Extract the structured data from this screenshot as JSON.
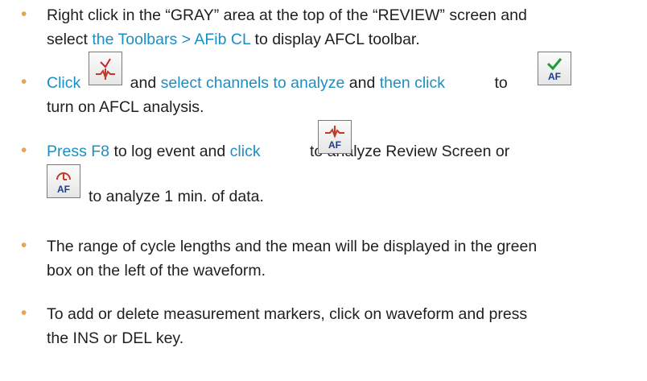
{
  "bullets": [
    {
      "line1": {
        "t1": "Right click in the “GRAY” area at the top of the “REVIEW” screen and"
      },
      "line2": {
        "t1": "select ",
        "link": "the Toolbars > AFib CL",
        "t2": " to display AFCL toolbar."
      }
    },
    {
      "line1": {
        "link1": "Click",
        "t1": " and ",
        "link2": "select channels to analyze",
        "t2": " and ",
        "link3": "then click",
        "t3": " to"
      },
      "line2": {
        "t1": "turn on AFCL analysis."
      }
    },
    {
      "line1": {
        "link1": "Press F8",
        "t1": " to log event and ",
        "link2": "click",
        "t2": " to analyze Review Screen or"
      },
      "line2": {
        "t1": "to analyze 1 min. of data."
      }
    },
    {
      "line1": {
        "t1": "The range of cycle lengths and the mean will be displayed in the green"
      },
      "line2": {
        "t1": "box on the left of the waveform."
      }
    },
    {
      "line1": {
        "t1": "To add or delete measurement markers, click on waveform and press"
      },
      "line2": {
        "t1": "the INS or DEL key."
      }
    }
  ],
  "icons": {
    "channel_select": "channel-select-icon",
    "afcl_on": "afcl-check-icon",
    "analyze_review": "afcl-review-icon",
    "analyze_minute": "afcl-timer-icon",
    "af_text": "AF"
  },
  "colors": {
    "link": "#1a8fc4",
    "bullet": "#e8a44a",
    "text": "#1f1f1f"
  }
}
